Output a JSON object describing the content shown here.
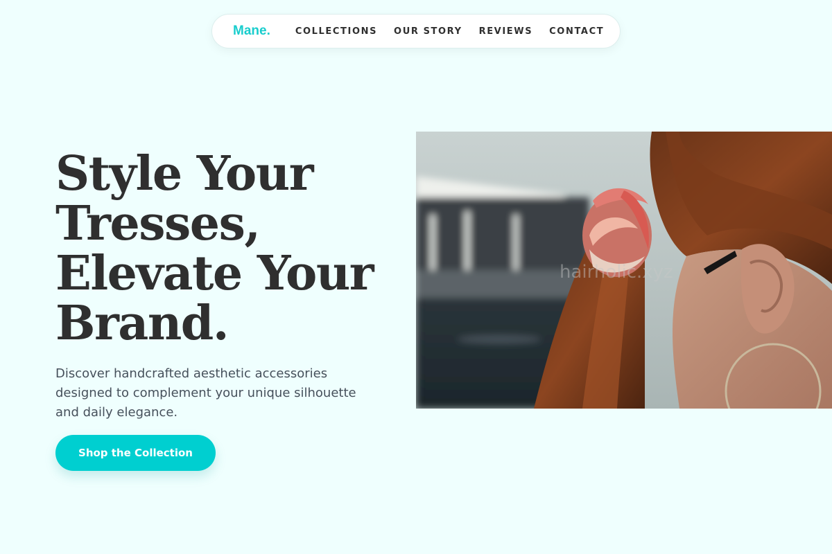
{
  "nav": {
    "logo": "Mane.",
    "links": [
      {
        "label": "COLLECTIONS"
      },
      {
        "label": "OUR STORY"
      },
      {
        "label": "REVIEWS"
      },
      {
        "label": "CONTACT"
      }
    ]
  },
  "hero": {
    "title_lines": [
      "Style Your",
      "Tresses,",
      "Elevate Your",
      "Brand."
    ],
    "subtitle": "Discover handcrafted aesthetic accessories designed to complement your unique silhouette and daily elegance.",
    "cta_label": "Shop the Collection",
    "image": {
      "icon": "hero-photo",
      "watermark": "hairholic.xyz"
    }
  },
  "colors": {
    "accent": "#00cfd0",
    "logo": "#19cdcd",
    "background": "#effffe",
    "text": "#2f2f2f"
  }
}
